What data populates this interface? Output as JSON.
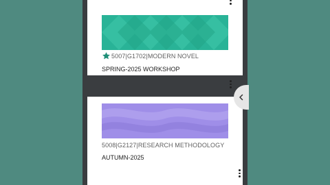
{
  "cards": [
    {
      "course_code": "5007|G1702|MODERN NOVEL",
      "course_name": "SPRING-2025 WORKSHOP",
      "banner_color": "#29b397",
      "starred": true,
      "star_color": "#1f8f78"
    },
    {
      "course_code": "5008|G2127|RESEARCH METHODOLOGY",
      "course_name": "AUTUMN-2025",
      "banner_color": "#9f8ee8",
      "starred": false
    }
  ],
  "icons": {
    "menu": "more-vertical-icon",
    "star": "star-icon",
    "collapse": "chevron-left-icon"
  },
  "colors": {
    "outer_background": "#4f8a80",
    "screen_background": "#3a3d40",
    "card_background": "#ffffff"
  }
}
